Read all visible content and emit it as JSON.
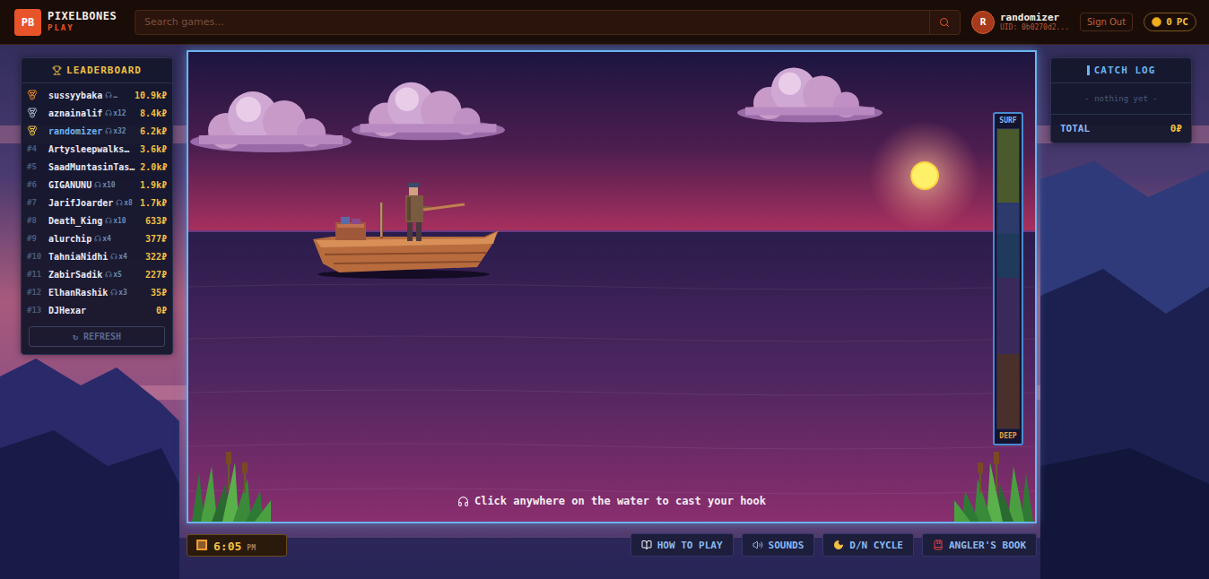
{
  "header": {
    "logo": {
      "mark": "PB",
      "title": "PIXELBONES",
      "subtitle": "PLAY"
    },
    "search": {
      "placeholder": "Search games..."
    },
    "user": {
      "avatar": "R",
      "name": "randomizer",
      "uid": "UID: 0b0270d2..."
    },
    "signOut": "Sign Out",
    "coins": {
      "amount": "0",
      "unit": "PC"
    }
  },
  "leaderboard": {
    "title": "LEADERBOARD",
    "rows": [
      {
        "kind": "medal",
        "rank": "#1",
        "color": "#e8892a",
        "name": "sussyybaka",
        "plays": "…",
        "score": "10.9k₽",
        "selected": false
      },
      {
        "kind": "medal",
        "rank": "#2",
        "color": "#a8b8d0",
        "name": "aznainalif",
        "plays": "x12",
        "score": "8.4k₽",
        "selected": false
      },
      {
        "kind": "medal",
        "rank": "#3",
        "color": "#e8c040",
        "name": "randomizer",
        "plays": "x32",
        "score": "6.2k₽",
        "selected": true
      },
      {
        "kind": "rank",
        "rank": "#4",
        "color": "#4a5a7a",
        "name": "Artysleepwalks…",
        "plays": "",
        "score": "3.6k₽",
        "selected": false
      },
      {
        "kind": "rank",
        "rank": "#5",
        "color": "#4a5a7a",
        "name": "SaadMuntasinTas…",
        "plays": "",
        "score": "2.0k₽",
        "selected": false
      },
      {
        "kind": "rank",
        "rank": "#6",
        "color": "#4a5a7a",
        "name": "GIGANUNU",
        "plays": "x10",
        "score": "1.9k₽",
        "selected": false
      },
      {
        "kind": "rank",
        "rank": "#7",
        "color": "#4a5a7a",
        "name": "JarifJoarder",
        "plays": "x8",
        "score": "1.7k₽",
        "selected": false
      },
      {
        "kind": "rank",
        "rank": "#8",
        "color": "#4a5a7a",
        "name": "Death_King",
        "plays": "x10",
        "score": "633₽",
        "selected": false
      },
      {
        "kind": "rank",
        "rank": "#9",
        "color": "#4a5a7a",
        "name": "alurchip",
        "plays": "x4",
        "score": "377₽",
        "selected": false
      },
      {
        "kind": "rank",
        "rank": "#10",
        "color": "#4a5a7a",
        "name": "TahniaNidhi",
        "plays": "x4",
        "score": "322₽",
        "selected": false
      },
      {
        "kind": "rank",
        "rank": "#11",
        "color": "#4a5a7a",
        "name": "ZabirSadik",
        "plays": "x5",
        "score": "227₽",
        "selected": false
      },
      {
        "kind": "rank",
        "rank": "#12",
        "color": "#4a5a7a",
        "name": "ElhanRashik",
        "plays": "x3",
        "score": "35₽",
        "selected": false
      },
      {
        "kind": "rank",
        "rank": "#13",
        "color": "#4a5a7a",
        "name": "DJHexar",
        "plays": "",
        "score": "0₽",
        "selected": false
      }
    ],
    "refresh": {
      "icon": "↻",
      "label": "REFRESH"
    }
  },
  "game": {
    "hint": "Click anywhere on the water to cast your hook",
    "depthMeter": {
      "top": "SURF",
      "bottom": "DEEP",
      "zones": [
        {
          "color": "#4a5a2c"
        },
        {
          "color": "#2c3a6c"
        },
        {
          "color": "#1f3a5c"
        },
        {
          "color": "#3a2a5c"
        },
        {
          "color": "#4a302a"
        }
      ]
    }
  },
  "catchLog": {
    "title": "CATCH LOG",
    "empty": "- nothing yet -",
    "totalLabel": "TOTAL",
    "total": "0₽"
  },
  "clock": {
    "time": "6:05",
    "period": "PM"
  },
  "controls": [
    {
      "kind": "help",
      "label": "HOW TO PLAY"
    },
    {
      "kind": "sound",
      "label": "SOUNDS"
    },
    {
      "kind": "cycle",
      "label": "D/N CYCLE"
    },
    {
      "kind": "book",
      "label": "ANGLER'S BOOK"
    }
  ]
}
